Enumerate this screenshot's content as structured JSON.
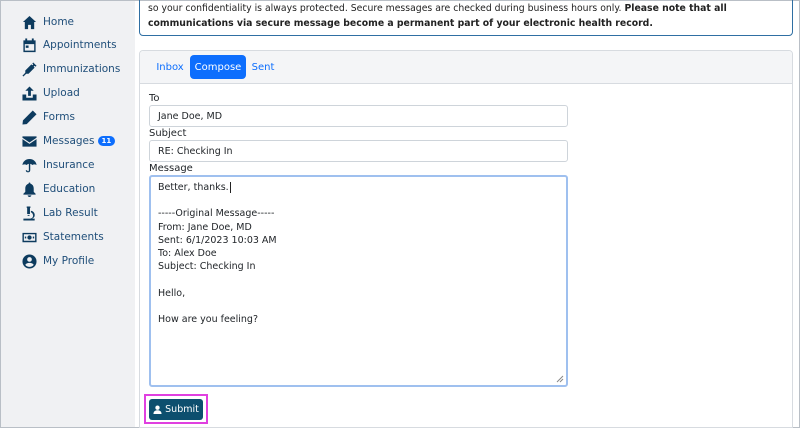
{
  "sidebar": {
    "items": [
      {
        "label": "Home",
        "icon": "home-icon"
      },
      {
        "label": "Appointments",
        "icon": "calendar-icon"
      },
      {
        "label": "Immunizations",
        "icon": "syringe-icon"
      },
      {
        "label": "Upload",
        "icon": "upload-icon"
      },
      {
        "label": "Forms",
        "icon": "pencil-icon"
      },
      {
        "label": "Messages",
        "icon": "envelope-icon",
        "badge": "11"
      },
      {
        "label": "Insurance",
        "icon": "umbrella-icon"
      },
      {
        "label": "Education",
        "icon": "bell-icon"
      },
      {
        "label": "Lab Result",
        "icon": "microscope-icon"
      },
      {
        "label": "Statements",
        "icon": "money-icon"
      },
      {
        "label": "My Profile",
        "icon": "user-circle-icon"
      }
    ]
  },
  "notice": {
    "text": "so your confidentiality is always protected. Secure messages are checked during business hours only. ",
    "bold": "Please note that all communications via secure message become a permanent part of your electronic health record."
  },
  "tabs": {
    "inbox": "Inbox",
    "compose": "Compose",
    "sent": "Sent"
  },
  "form": {
    "to_label": "To",
    "to_value": "Jane Doe, MD",
    "subject_label": "Subject",
    "subject_value": "RE: Checking In",
    "message_label": "Message",
    "message_lines": [
      "Better, thanks.",
      "",
      "-----Original Message-----",
      "From: Jane Doe, MD",
      "Sent: 6/1/2023 10:03 AM",
      "To: Alex Doe",
      "Subject: Checking In",
      "",
      "Hello,",
      "",
      "How are you feeling?"
    ],
    "submit_label": "Submit"
  },
  "colors": {
    "primary": "#0d6efd",
    "nav_icon": "#0d3b5e",
    "submit_bg": "#0d4f6e",
    "highlight_outline": "#e040e0"
  }
}
